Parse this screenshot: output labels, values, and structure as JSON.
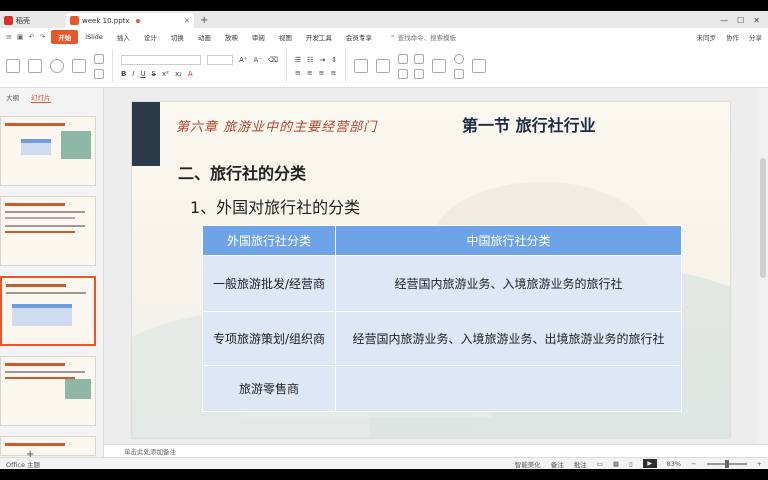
{
  "tabs": {
    "home_label": "稻壳",
    "doc_label": "week 10.pptx"
  },
  "menu": {
    "items": [
      "开始",
      "iSlide",
      "插入",
      "设计",
      "切换",
      "动画",
      "放映",
      "审阅",
      "视图",
      "开发工具",
      "会员专享"
    ],
    "search_text": "查找命令、搜索模板",
    "right": [
      "未同步",
      "协作",
      "分享"
    ]
  },
  "pane": {
    "tab_outline": "大纲",
    "tab_slides": "幻灯片",
    "add": "+"
  },
  "slide": {
    "chapter": "第六章 旅游业中的主要经营部门",
    "section": "第一节 旅行社行业",
    "heading": "二、旅行社的分类",
    "sub": "1、外国对旅行社的分类",
    "table": {
      "headers": [
        "外国旅行社分类",
        "中国旅行社分类"
      ],
      "rows": [
        [
          "一般旅游批发/经营商",
          "经营国内旅游业务、入境旅游业务的旅行社"
        ],
        [
          "专项旅游策划/组织商",
          "经营国内旅游业务、入境旅游业务、出境旅游业务的旅行社"
        ],
        [
          "旅游零售商",
          ""
        ]
      ]
    }
  },
  "notes_placeholder": "单击此处添加备注",
  "status": {
    "left": "Office 主题",
    "smart": "智能美化",
    "notes": "备注",
    "comment": "批注",
    "zoom": "83%"
  }
}
